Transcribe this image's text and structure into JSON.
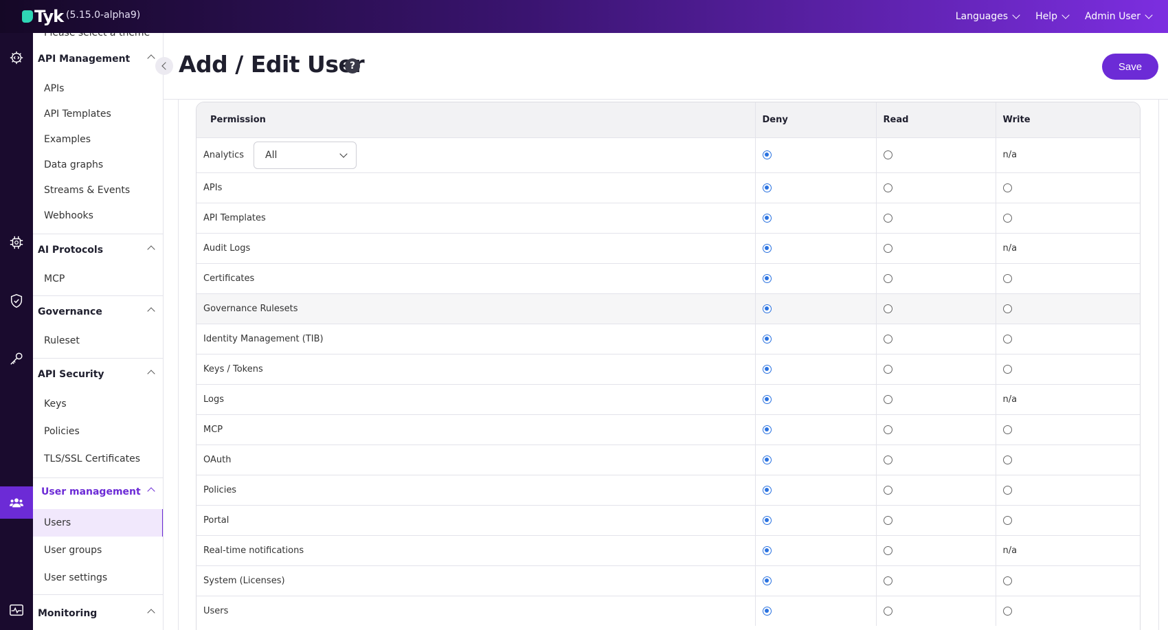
{
  "topbar": {
    "logo_text": "Tyk",
    "version": "(5.15.0-alpha9)",
    "nav": [
      {
        "label": "Languages"
      },
      {
        "label": "Help"
      },
      {
        "label": "Admin User"
      }
    ]
  },
  "sidebar": {
    "cut_item": "Please select a theme",
    "sections": [
      {
        "title": "API Management",
        "items": [
          "APIs",
          "API Templates",
          "Examples",
          "Data graphs",
          "Streams & Events",
          "Webhooks"
        ]
      },
      {
        "title": "AI Protocols",
        "items": [
          "MCP"
        ]
      },
      {
        "title": "Governance",
        "items": [
          "Ruleset"
        ]
      },
      {
        "title": "API Security",
        "items": [
          "Keys",
          "Policies",
          "TLS/SSL Certificates"
        ]
      },
      {
        "title": "User management",
        "items": [
          "Users",
          "User groups",
          "User settings"
        ]
      },
      {
        "title": "Monitoring",
        "items": []
      }
    ],
    "active_item": "Users"
  },
  "header": {
    "title": "Add / Edit User",
    "help_glyph": "?",
    "save_label": "Save"
  },
  "permissions": {
    "columns": [
      "Permission",
      "Deny",
      "Read",
      "Write"
    ],
    "analytics_select": "All",
    "na_label": "n/a",
    "rows": [
      {
        "name": "Analytics",
        "value": "deny",
        "write": "n/a"
      },
      {
        "name": "APIs",
        "value": "deny",
        "write": "radio"
      },
      {
        "name": "API Templates",
        "value": "deny",
        "write": "radio"
      },
      {
        "name": "Audit Logs",
        "value": "deny",
        "write": "n/a"
      },
      {
        "name": "Certificates",
        "value": "deny",
        "write": "radio"
      },
      {
        "name": "Governance Rulesets",
        "value": "deny",
        "write": "radio"
      },
      {
        "name": "Identity Management (TIB)",
        "value": "deny",
        "write": "radio"
      },
      {
        "name": "Keys / Tokens",
        "value": "deny",
        "write": "radio"
      },
      {
        "name": "Logs",
        "value": "deny",
        "write": "n/a"
      },
      {
        "name": "MCP",
        "value": "deny",
        "write": "radio"
      },
      {
        "name": "OAuth",
        "value": "deny",
        "write": "radio"
      },
      {
        "name": "Policies",
        "value": "deny",
        "write": "radio"
      },
      {
        "name": "Portal",
        "value": "deny",
        "write": "radio"
      },
      {
        "name": "Real-time notifications",
        "value": "deny",
        "write": "n/a"
      },
      {
        "name": "System (Licenses)",
        "value": "deny",
        "write": "radio"
      },
      {
        "name": "Users",
        "value": "deny",
        "write": "radio"
      }
    ]
  },
  "colors": {
    "accent": "#6c2bd6",
    "radio_selected": "#2a72e0"
  }
}
